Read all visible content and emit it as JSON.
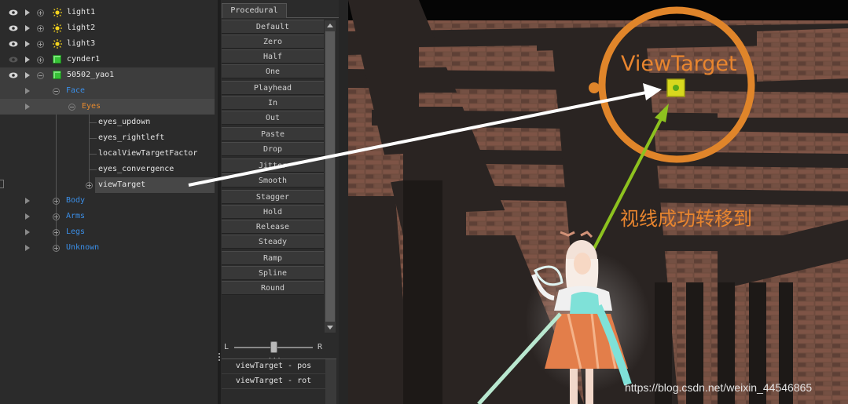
{
  "outliner": {
    "lights": [
      {
        "label": "light1"
      },
      {
        "label": "light2"
      },
      {
        "label": "light3"
      }
    ],
    "cylinder_label": "cynder1",
    "character_label": "50502_yao1",
    "groups": {
      "face": "Face",
      "eyes": "Eyes",
      "body": "Body",
      "arms": "Arms",
      "legs": "Legs",
      "unknown": "Unknown"
    },
    "eye_controls": [
      "eyes_updown",
      "eyes_rightleft",
      "localViewTargetFactor",
      "eyes_convergence",
      "viewTarget"
    ],
    "colors": {
      "group_blue": "#3b8fe8",
      "group_orange": "#e68a2e",
      "cube_green": "#36c236",
      "light_yellow": "#f2d21e"
    }
  },
  "procedural": {
    "tab_label": "Procedural",
    "buttons": [
      "Default",
      "Zero",
      "Half",
      "One",
      "Playhead",
      "In",
      "Out",
      "Paste",
      "Drop",
      "Jitter",
      "Smooth",
      "Stagger",
      "Hold",
      "Release",
      "Steady",
      "Ramp",
      "Spline",
      "Round"
    ],
    "slider": {
      "left_label": "L",
      "right_label": "R",
      "value": 0.5
    },
    "channels": [
      "viewTarget - pos",
      "viewTarget - rot"
    ]
  },
  "viewport": {
    "target_label": "ViewTarget",
    "annotation_text": "视线成功转移到",
    "watermark": "https://blog.csdn.net/weixin_44546865",
    "colors": {
      "annotation_orange": "#e8852f",
      "gaze_green": "#8dc21f",
      "arrow_white": "#ffffff",
      "target_yellow": "#d8d81e"
    }
  }
}
